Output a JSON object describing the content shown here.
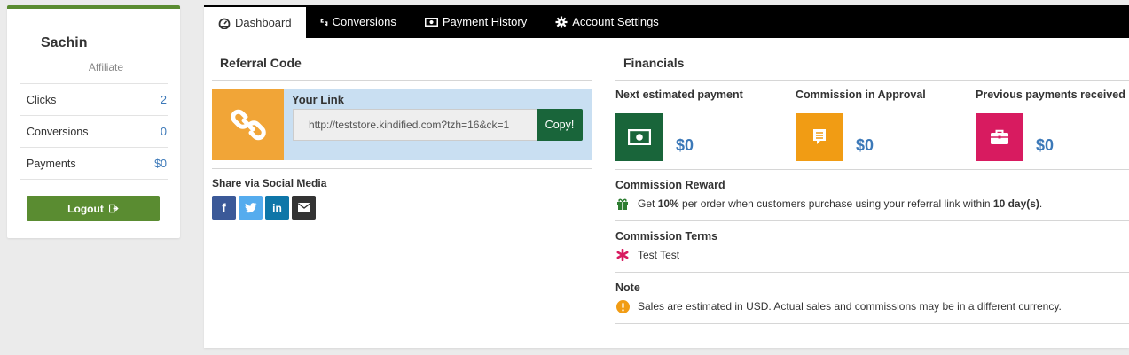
{
  "sidebar": {
    "name": "Sachin",
    "role": "Affiliate",
    "stats": [
      {
        "label": "Clicks",
        "value": "2"
      },
      {
        "label": "Conversions",
        "value": "0"
      },
      {
        "label": "Payments",
        "value": "$0"
      }
    ],
    "logout_label": "Logout"
  },
  "tabs": [
    {
      "label": "Dashboard",
      "icon": "dashboard-icon"
    },
    {
      "label": "Conversions",
      "icon": "conversions-icon"
    },
    {
      "label": "Payment History",
      "icon": "money-icon"
    },
    {
      "label": "Account Settings",
      "icon": "gear-icon"
    }
  ],
  "referral": {
    "title": "Referral Code",
    "link_label": "Your Link",
    "link_value": "http://teststore.kindified.com?tzh=16&ck=1",
    "copy_label": "Copy!",
    "share_title": "Share via Social Media",
    "social": [
      {
        "name": "facebook",
        "glyph": "f",
        "color": "#3b5998"
      },
      {
        "name": "twitter",
        "glyph": "t",
        "color": "#55acee"
      },
      {
        "name": "linkedin",
        "glyph": "in",
        "color": "#0e76a8"
      },
      {
        "name": "email",
        "glyph": "✉",
        "color": "#333333"
      }
    ]
  },
  "financials": {
    "title": "Financials",
    "cards": [
      {
        "label": "Next estimated payment",
        "amount": "$0",
        "color": "#19653a",
        "icon": "money-bill-icon"
      },
      {
        "label": "Commission in Approval",
        "amount": "$0",
        "color": "#f19c14",
        "icon": "receipt-icon"
      },
      {
        "label": "Previous payments received",
        "amount": "$0",
        "color": "#d81b60",
        "icon": "briefcase-icon"
      }
    ],
    "reward": {
      "title": "Commission Reward",
      "pre": "Get ",
      "percent": "10%",
      "mid": " per order when customers purchase using your referral link within ",
      "days": "10 day(s)",
      "post": "."
    },
    "terms": {
      "title": "Commission Terms",
      "text": "Test Test"
    },
    "note": {
      "title": "Note",
      "text": "Sales are estimated in USD. Actual sales and commissions may be in a different currency."
    }
  },
  "colors": {
    "accent_green": "#5a8c31",
    "link_blue": "#3b78b8",
    "gift_green": "#2e7d32",
    "asterisk": "#d81b60",
    "warning": "#f19c14"
  }
}
